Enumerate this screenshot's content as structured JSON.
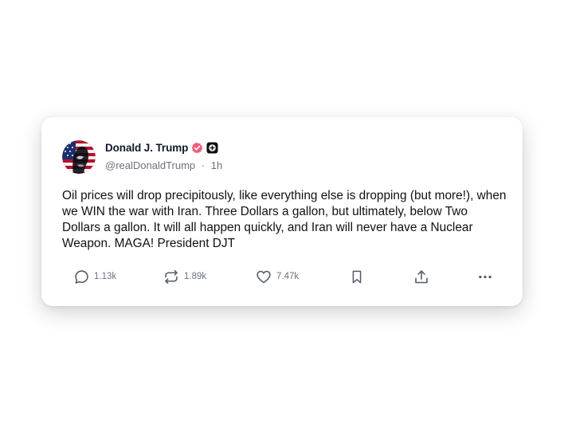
{
  "post": {
    "author_name": "Donald J. Trump",
    "handle": "@realDonaldTrump",
    "separator": "·",
    "time": "1h",
    "text": "Oil prices will drop precipitously, like everything else is dropping (but more!), when we WIN the war with Iran. Three Dollars a gallon, but ultimately, below Two Dollars a gallon. It will all happen quickly, and Iran will never have a Nuclear Weapon. MAGA! President DJT",
    "verified_badge_icon": "verified-badge-icon",
    "extra_badge_icon": "plus-badge-icon",
    "badge_color": "#f45b7a"
  },
  "actions": {
    "reply": {
      "icon": "reply-icon",
      "count": "1.13k"
    },
    "repost": {
      "icon": "repost-icon",
      "count": "1.89k"
    },
    "like": {
      "icon": "heart-icon",
      "count": "7.47k"
    },
    "bookmark": {
      "icon": "bookmark-icon"
    },
    "share": {
      "icon": "share-icon"
    },
    "more": {
      "icon": "more-icon"
    }
  }
}
